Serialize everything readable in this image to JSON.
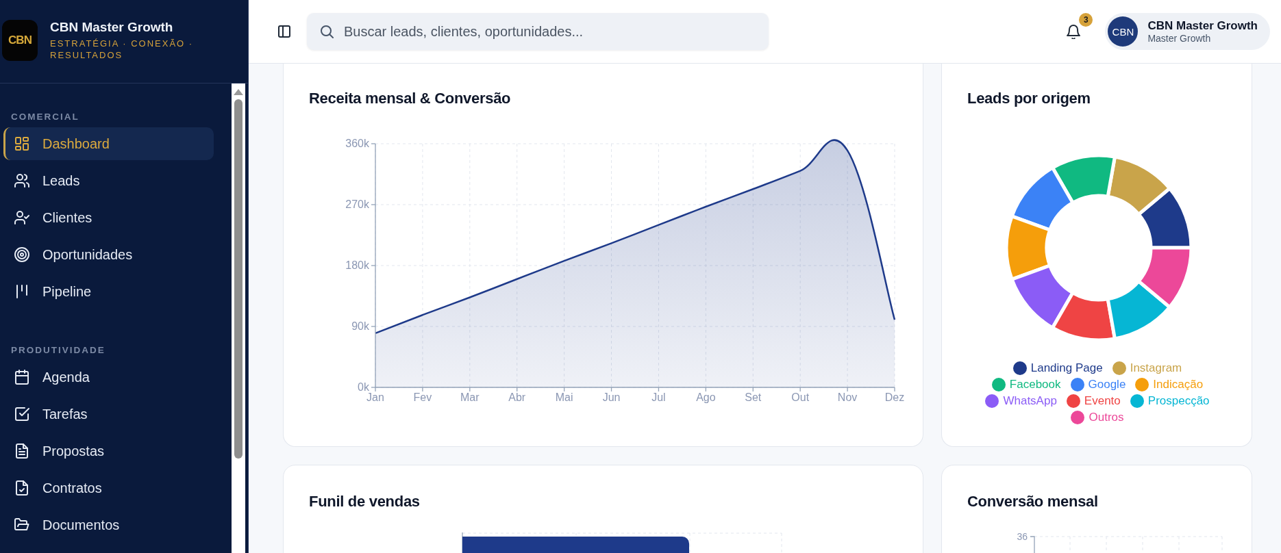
{
  "brand": {
    "logo_text": "CBN",
    "name": "CBN Master Growth",
    "tagline": "ESTRATÉGIA · CONEXÃO · RESULTADOS"
  },
  "sidebar": {
    "sections": [
      {
        "title": "COMERCIAL",
        "items": [
          {
            "label": "Dashboard",
            "selected": true
          },
          {
            "label": "Leads",
            "selected": false
          },
          {
            "label": "Clientes",
            "selected": false
          },
          {
            "label": "Oportunidades",
            "selected": false
          },
          {
            "label": "Pipeline",
            "selected": false
          }
        ]
      },
      {
        "title": "PRODUTIVIDADE",
        "items": [
          {
            "label": "Agenda",
            "selected": false
          },
          {
            "label": "Tarefas",
            "selected": false
          },
          {
            "label": "Propostas",
            "selected": false
          },
          {
            "label": "Contratos",
            "selected": false
          },
          {
            "label": "Documentos",
            "selected": false
          }
        ]
      }
    ]
  },
  "topbar": {
    "search": {
      "placeholder": "Buscar leads, clientes, oportunidades..."
    },
    "notifications": {
      "count": "3"
    },
    "user": {
      "avatar_text": "CBN",
      "name": "CBN Master Growth",
      "subtitle": "Master Growth"
    }
  },
  "revenue_card": {
    "chart_data": {
      "type": "area",
      "title": "Receita mensal & Conversão",
      "categories": [
        "Jan",
        "Fev",
        "Mar",
        "Abr",
        "Mai",
        "Jun",
        "Jul",
        "Ago",
        "Set",
        "Out",
        "Nov",
        "Dez"
      ],
      "series": [
        {
          "color": "#1e3a8a",
          "values": [
            80000,
            107000,
            133000,
            160000,
            187000,
            213000,
            240000,
            267000,
            293000,
            320000,
            350000,
            100000
          ]
        }
      ],
      "grid": true,
      "ylim": [
        0,
        360000
      ],
      "yticks": [
        {
          "value": 0,
          "label": "0k"
        },
        {
          "value": 90000,
          "label": "90k"
        },
        {
          "value": 180000,
          "label": "180k"
        },
        {
          "value": 270000,
          "label": "270k"
        },
        {
          "value": 360000,
          "label": "360k"
        }
      ]
    }
  },
  "leads_card": {
    "title": "Leads por origem",
    "legend": [
      {
        "label": "Landing Page",
        "color": "#1e3a8a"
      },
      {
        "label": "Instagram",
        "color": "#c9a44a"
      },
      {
        "label": "Facebook",
        "color": "#10b981"
      },
      {
        "label": "Google",
        "color": "#3b82f6"
      },
      {
        "label": "Indicação",
        "color": "#f59e0b"
      },
      {
        "label": "WhatsApp",
        "color": "#8b5cf6"
      },
      {
        "label": "Evento",
        "color": "#ef4444"
      },
      {
        "label": "Prospecção",
        "color": "#06b6d4"
      },
      {
        "label": "Outros",
        "color": "#ec4899"
      }
    ]
  },
  "funnel_card": {
    "title": "Funil de vendas"
  },
  "conversion_card": {
    "title": "Conversão mensal",
    "tick_label": "36"
  }
}
